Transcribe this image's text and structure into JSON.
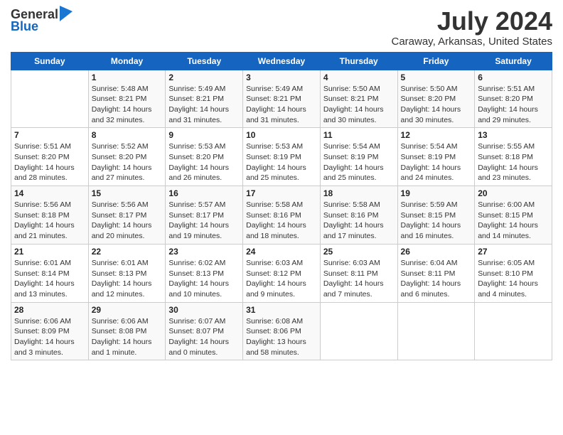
{
  "logo": {
    "general": "General",
    "blue": "Blue"
  },
  "title": "July 2024",
  "subtitle": "Caraway, Arkansas, United States",
  "days_header": [
    "Sunday",
    "Monday",
    "Tuesday",
    "Wednesday",
    "Thursday",
    "Friday",
    "Saturday"
  ],
  "weeks": [
    [
      {
        "day": "",
        "info": ""
      },
      {
        "day": "1",
        "info": "Sunrise: 5:48 AM\nSunset: 8:21 PM\nDaylight: 14 hours\nand 32 minutes."
      },
      {
        "day": "2",
        "info": "Sunrise: 5:49 AM\nSunset: 8:21 PM\nDaylight: 14 hours\nand 31 minutes."
      },
      {
        "day": "3",
        "info": "Sunrise: 5:49 AM\nSunset: 8:21 PM\nDaylight: 14 hours\nand 31 minutes."
      },
      {
        "day": "4",
        "info": "Sunrise: 5:50 AM\nSunset: 8:21 PM\nDaylight: 14 hours\nand 30 minutes."
      },
      {
        "day": "5",
        "info": "Sunrise: 5:50 AM\nSunset: 8:20 PM\nDaylight: 14 hours\nand 30 minutes."
      },
      {
        "day": "6",
        "info": "Sunrise: 5:51 AM\nSunset: 8:20 PM\nDaylight: 14 hours\nand 29 minutes."
      }
    ],
    [
      {
        "day": "7",
        "info": "Sunrise: 5:51 AM\nSunset: 8:20 PM\nDaylight: 14 hours\nand 28 minutes."
      },
      {
        "day": "8",
        "info": "Sunrise: 5:52 AM\nSunset: 8:20 PM\nDaylight: 14 hours\nand 27 minutes."
      },
      {
        "day": "9",
        "info": "Sunrise: 5:53 AM\nSunset: 8:20 PM\nDaylight: 14 hours\nand 26 minutes."
      },
      {
        "day": "10",
        "info": "Sunrise: 5:53 AM\nSunset: 8:19 PM\nDaylight: 14 hours\nand 25 minutes."
      },
      {
        "day": "11",
        "info": "Sunrise: 5:54 AM\nSunset: 8:19 PM\nDaylight: 14 hours\nand 25 minutes."
      },
      {
        "day": "12",
        "info": "Sunrise: 5:54 AM\nSunset: 8:19 PM\nDaylight: 14 hours\nand 24 minutes."
      },
      {
        "day": "13",
        "info": "Sunrise: 5:55 AM\nSunset: 8:18 PM\nDaylight: 14 hours\nand 23 minutes."
      }
    ],
    [
      {
        "day": "14",
        "info": "Sunrise: 5:56 AM\nSunset: 8:18 PM\nDaylight: 14 hours\nand 21 minutes."
      },
      {
        "day": "15",
        "info": "Sunrise: 5:56 AM\nSunset: 8:17 PM\nDaylight: 14 hours\nand 20 minutes."
      },
      {
        "day": "16",
        "info": "Sunrise: 5:57 AM\nSunset: 8:17 PM\nDaylight: 14 hours\nand 19 minutes."
      },
      {
        "day": "17",
        "info": "Sunrise: 5:58 AM\nSunset: 8:16 PM\nDaylight: 14 hours\nand 18 minutes."
      },
      {
        "day": "18",
        "info": "Sunrise: 5:58 AM\nSunset: 8:16 PM\nDaylight: 14 hours\nand 17 minutes."
      },
      {
        "day": "19",
        "info": "Sunrise: 5:59 AM\nSunset: 8:15 PM\nDaylight: 14 hours\nand 16 minutes."
      },
      {
        "day": "20",
        "info": "Sunrise: 6:00 AM\nSunset: 8:15 PM\nDaylight: 14 hours\nand 14 minutes."
      }
    ],
    [
      {
        "day": "21",
        "info": "Sunrise: 6:01 AM\nSunset: 8:14 PM\nDaylight: 14 hours\nand 13 minutes."
      },
      {
        "day": "22",
        "info": "Sunrise: 6:01 AM\nSunset: 8:13 PM\nDaylight: 14 hours\nand 12 minutes."
      },
      {
        "day": "23",
        "info": "Sunrise: 6:02 AM\nSunset: 8:13 PM\nDaylight: 14 hours\nand 10 minutes."
      },
      {
        "day": "24",
        "info": "Sunrise: 6:03 AM\nSunset: 8:12 PM\nDaylight: 14 hours\nand 9 minutes."
      },
      {
        "day": "25",
        "info": "Sunrise: 6:03 AM\nSunset: 8:11 PM\nDaylight: 14 hours\nand 7 minutes."
      },
      {
        "day": "26",
        "info": "Sunrise: 6:04 AM\nSunset: 8:11 PM\nDaylight: 14 hours\nand 6 minutes."
      },
      {
        "day": "27",
        "info": "Sunrise: 6:05 AM\nSunset: 8:10 PM\nDaylight: 14 hours\nand 4 minutes."
      }
    ],
    [
      {
        "day": "28",
        "info": "Sunrise: 6:06 AM\nSunset: 8:09 PM\nDaylight: 14 hours\nand 3 minutes."
      },
      {
        "day": "29",
        "info": "Sunrise: 6:06 AM\nSunset: 8:08 PM\nDaylight: 14 hours\nand 1 minute."
      },
      {
        "day": "30",
        "info": "Sunrise: 6:07 AM\nSunset: 8:07 PM\nDaylight: 14 hours\nand 0 minutes."
      },
      {
        "day": "31",
        "info": "Sunrise: 6:08 AM\nSunset: 8:06 PM\nDaylight: 13 hours\nand 58 minutes."
      },
      {
        "day": "",
        "info": ""
      },
      {
        "day": "",
        "info": ""
      },
      {
        "day": "",
        "info": ""
      }
    ]
  ]
}
